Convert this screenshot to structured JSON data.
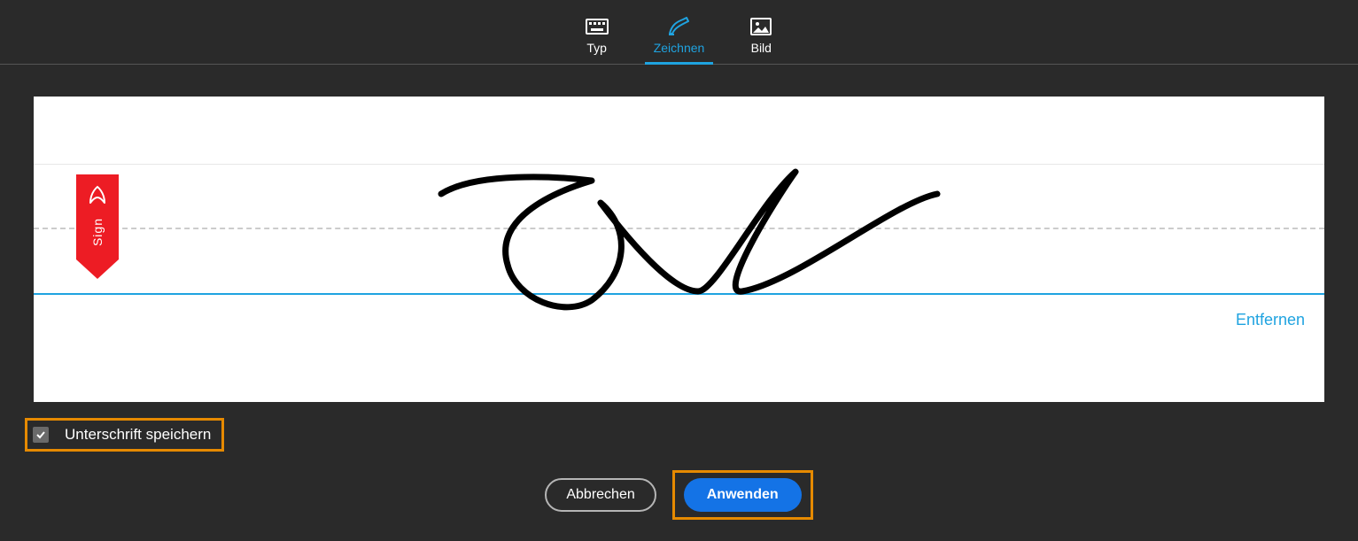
{
  "tabs": {
    "type": "Typ",
    "draw": "Zeichnen",
    "image": "Bild"
  },
  "ribbon": {
    "label": "Sign"
  },
  "clear": "Entfernen",
  "save": {
    "label": "Unterschrift speichern",
    "checked": true
  },
  "actions": {
    "cancel": "Abbrechen",
    "apply": "Anwenden"
  }
}
